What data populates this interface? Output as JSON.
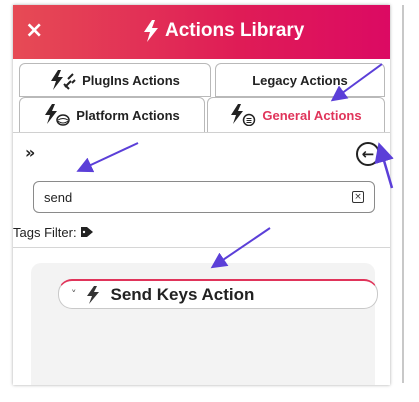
{
  "header": {
    "title": "Actions Library",
    "close_label": "×"
  },
  "tabs": [
    {
      "label": "PlugIns Actions"
    },
    {
      "label": "Legacy Actions"
    },
    {
      "label": "Platform Actions"
    },
    {
      "label": "General Actions",
      "active": true
    }
  ],
  "search": {
    "value": "send",
    "clear_label": "×"
  },
  "tags_filter": {
    "label": "Tags Filter:"
  },
  "actions": [
    {
      "name": "Send Keys Action"
    }
  ],
  "colors": {
    "accent": "#e0345a",
    "header_start": "#e64b55",
    "header_end": "#dc0a63",
    "annotation_arrow": "#5b3fd8"
  },
  "icons": [
    "close-icon",
    "bolt-icon",
    "plug-icon",
    "platform-icon",
    "general-icon",
    "collapse-icon",
    "back-arrow-icon",
    "clear-icon",
    "tag-icon",
    "chevron-icon"
  ]
}
